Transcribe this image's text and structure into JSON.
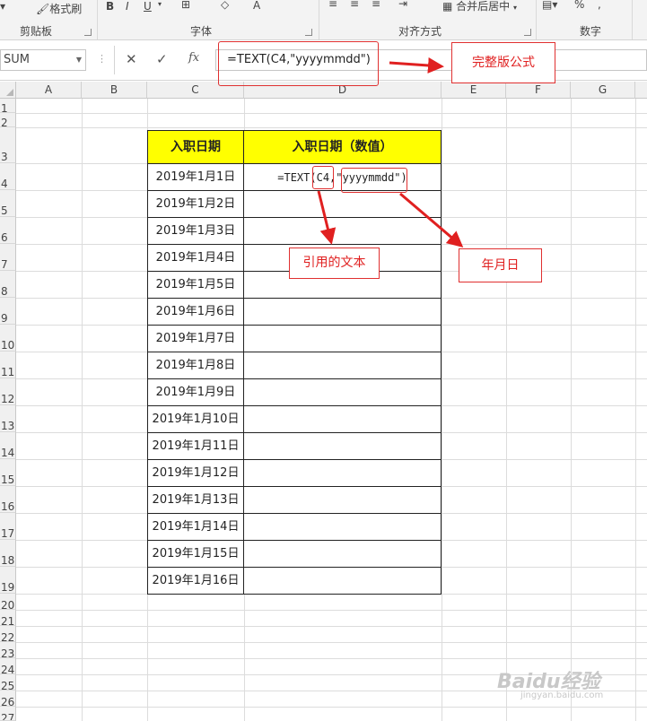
{
  "ribbon": {
    "format_painter": "格式刷",
    "groups": {
      "clipboard": "剪贴板",
      "font": "字体",
      "alignment": "对齐方式",
      "number": "数字"
    },
    "merge_center": "合并后居中"
  },
  "formula_bar": {
    "name_box": "SUM",
    "cancel": "✕",
    "enter": "✓",
    "fx": "fx",
    "formula": "=TEXT(C4,\"yyyymmdd\")"
  },
  "columns": [
    "A",
    "B",
    "C",
    "D",
    "E",
    "F",
    "G"
  ],
  "rows": [
    "1",
    "2",
    "3",
    "4",
    "5",
    "6",
    "7",
    "8",
    "9",
    "10",
    "11",
    "12",
    "13",
    "14",
    "15",
    "16",
    "17",
    "18",
    "19",
    "20",
    "21",
    "22",
    "23",
    "24",
    "25",
    "26",
    "27"
  ],
  "table": {
    "header_c": "入职日期",
    "header_d": "入职日期（数值）",
    "d4_formula": "=TEXT(C4,\"yyyymmdd\")",
    "dates": [
      "2019年1月1日",
      "2019年1月2日",
      "2019年1月3日",
      "2019年1月4日",
      "2019年1月5日",
      "2019年1月6日",
      "2019年1月7日",
      "2019年1月8日",
      "2019年1月9日",
      "2019年1月10日",
      "2019年1月11日",
      "2019年1月12日",
      "2019年1月13日",
      "2019年1月14日",
      "2019年1月15日",
      "2019年1月16日"
    ]
  },
  "annotations": {
    "full_formula": "完整版公式",
    "referenced_text": "引用的文本",
    "ymd": "年月日",
    "accent": "#e02020"
  },
  "watermark": {
    "brand": "Baidu经验",
    "url": "jingyan.baidu.com"
  }
}
